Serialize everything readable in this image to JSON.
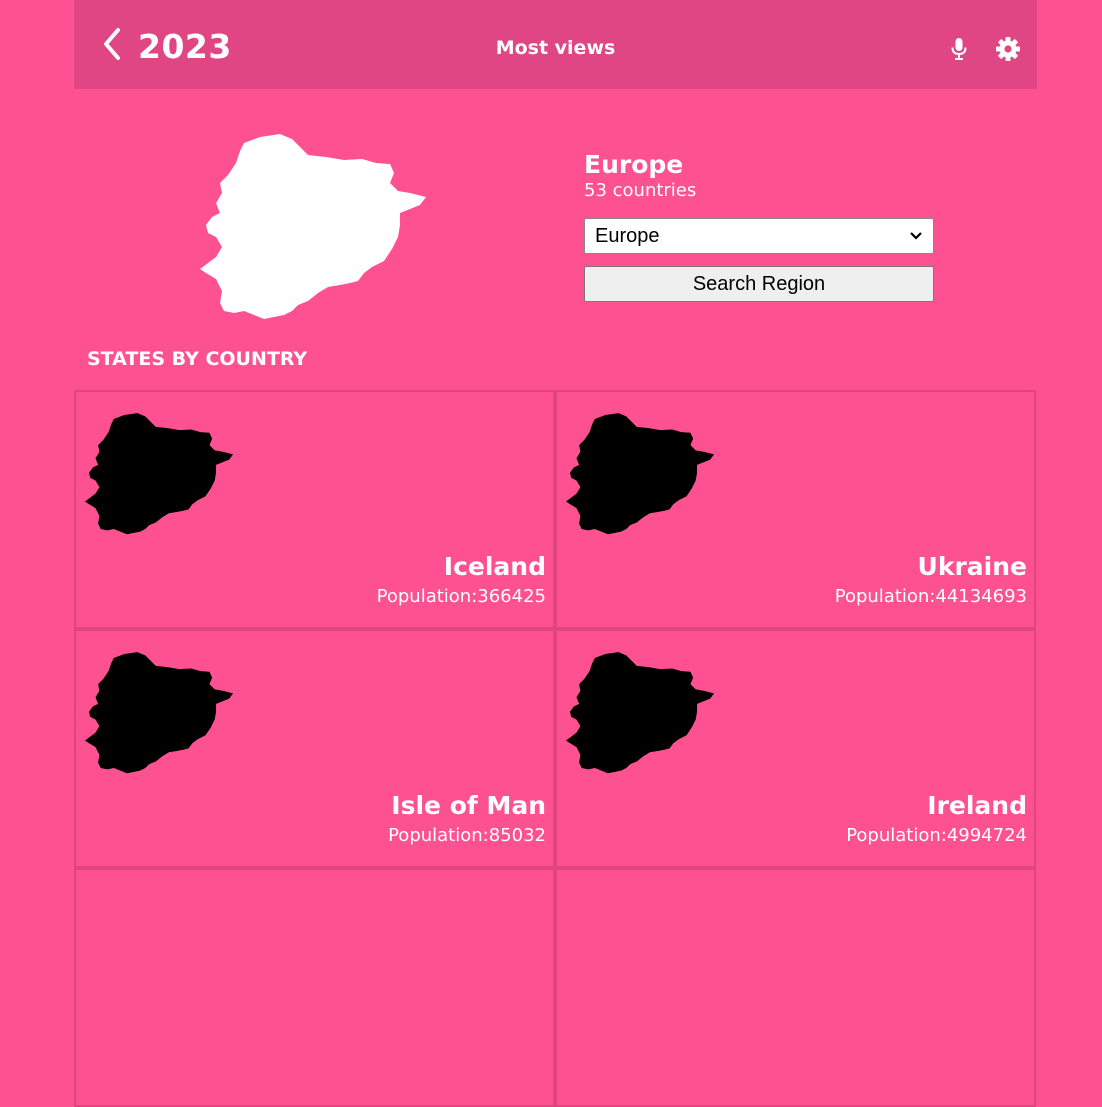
{
  "header": {
    "back_icon": "chevron-left-icon",
    "title": "2023",
    "center": "Most views",
    "mic_icon": "microphone-icon",
    "settings_icon": "gear-icon"
  },
  "region": {
    "name": "Europe",
    "count": "53 countries",
    "select_value": "Europe",
    "search_label": "Search Region"
  },
  "section_title": "STATES BY COUNTRY",
  "cards": [
    {
      "name": "Iceland",
      "population": "Population:366425"
    },
    {
      "name": "Ukraine",
      "population": "Population:44134693"
    },
    {
      "name": "Isle of Man",
      "population": "Population:85032"
    },
    {
      "name": "Ireland",
      "population": "Population:4994724"
    }
  ],
  "colors": {
    "background": "#fe5192",
    "header": "#df4683",
    "card_border": "#e0457f",
    "map_hero": "#ffffff",
    "map_card": "#000000"
  }
}
